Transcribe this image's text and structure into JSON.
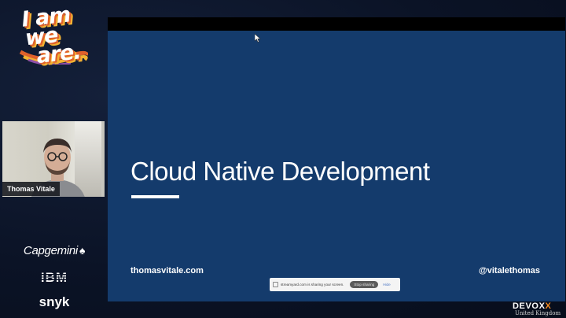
{
  "event": {
    "logo_text": [
      "I am",
      "we",
      "are."
    ],
    "accent": "#f2b233"
  },
  "speaker": {
    "name": "Thomas Vitale"
  },
  "sponsors": {
    "capgemini": "Capgemini",
    "ibm": "IBM",
    "snyk": "snyk"
  },
  "slide": {
    "title": "Cloud Native Development",
    "website": "thomasvitale.com",
    "handle": "@vitalethomas",
    "background": "#143b6c"
  },
  "share_bar": {
    "message": "streamyard.com is sharing your screen.",
    "stop_label": "Stop sharing",
    "hide_label": "Hide"
  },
  "conference": {
    "name_main": "DEVOX",
    "name_accent": "X",
    "subtitle": "United Kingdom"
  }
}
